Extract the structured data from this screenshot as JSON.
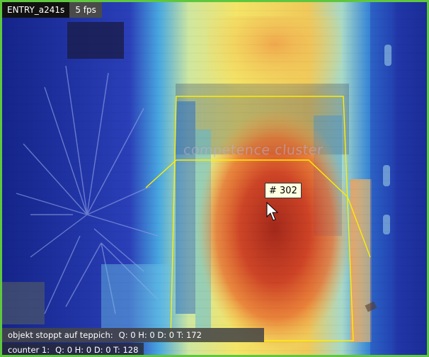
{
  "camera": {
    "name": "ENTRY_a241s",
    "fps": "5 fps"
  },
  "scene": {
    "watermark_text": "competence cluster",
    "colors": {
      "border": "#5fc73f",
      "zone_outline": "#ffee00",
      "heat_low": "#1e2f8a",
      "heat_mid": "#f2e25a",
      "heat_high": "#c0241c"
    }
  },
  "tracked_object": {
    "label": "# 302"
  },
  "counters": [
    {
      "name": "objekt stoppt auf teppich:",
      "values": "Q: 0 H: 0 D: 0 T: 172"
    },
    {
      "name": "counter 1:",
      "values": "Q: 0 H: 0 D: 0 T: 128"
    }
  ],
  "icons": {
    "cursor": "pointer-arrow-icon"
  }
}
